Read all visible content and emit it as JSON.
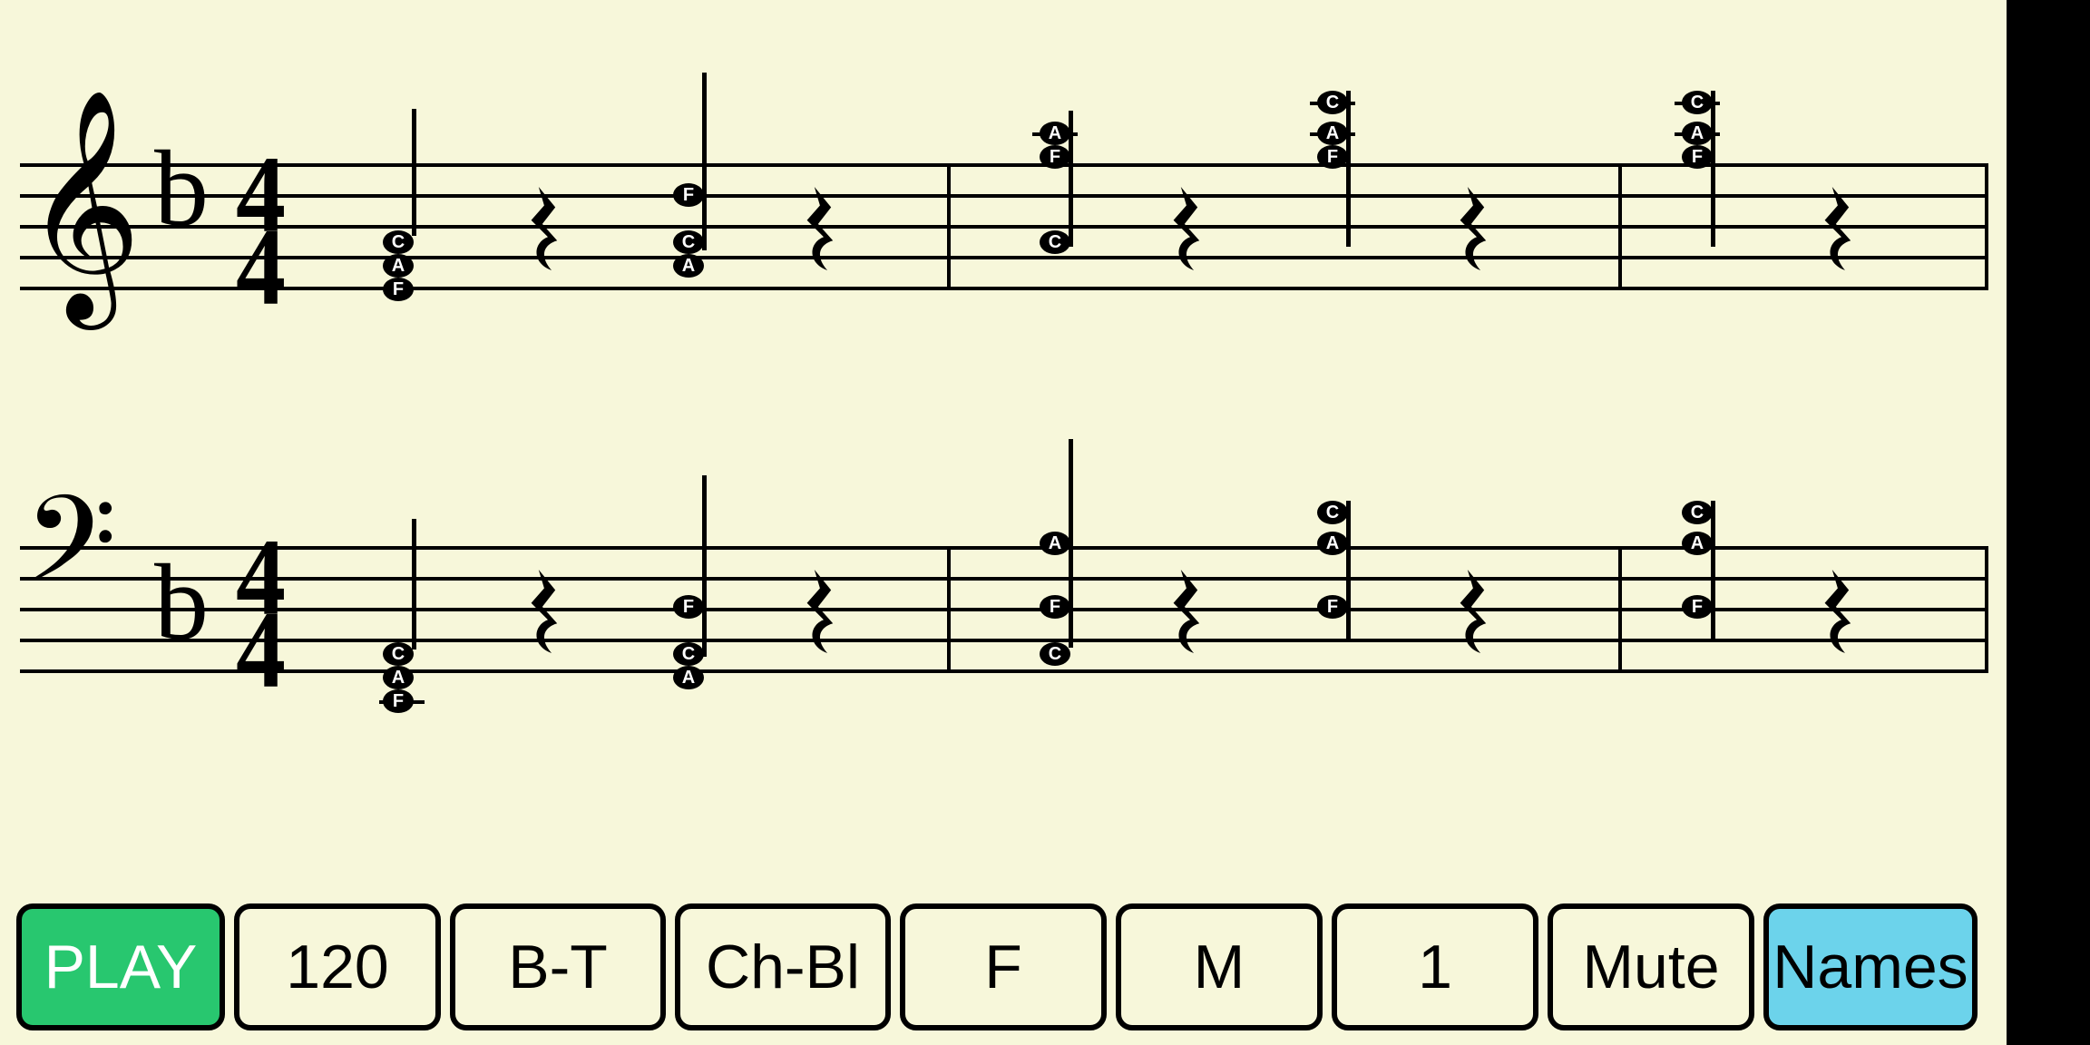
{
  "toolbar": {
    "play": "PLAY",
    "tempo": "120",
    "bt": "B-T",
    "chbl": "Ch-Bl",
    "key": "F",
    "mode": "M",
    "inv": "1",
    "mute": "Mute",
    "names": "Names"
  },
  "notation": {
    "time_sig_top": "4",
    "time_sig_bot": "4",
    "key_sig": "b",
    "staves": [
      {
        "clef": "treble"
      },
      {
        "clef": "bass"
      }
    ],
    "chart_data": {
      "type": "musical-score",
      "key": "F major",
      "time": "4/4",
      "pattern": "quarter-chord, quarter-rest (repeated)",
      "measures": [
        {
          "chord": [
            "F",
            "A",
            "C"
          ],
          "inversion": "root"
        },
        {
          "chord": [
            "A",
            "C",
            "F"
          ],
          "inversion": "first"
        },
        {
          "chord": [
            "C",
            "F",
            "A"
          ],
          "inversion": "second"
        },
        {
          "chord": [
            "F",
            "A",
            "C"
          ],
          "inversion": "root-octave-up"
        },
        {
          "chord": [
            "F",
            "A",
            "C"
          ],
          "inversion": "root-octave-up"
        }
      ]
    }
  }
}
